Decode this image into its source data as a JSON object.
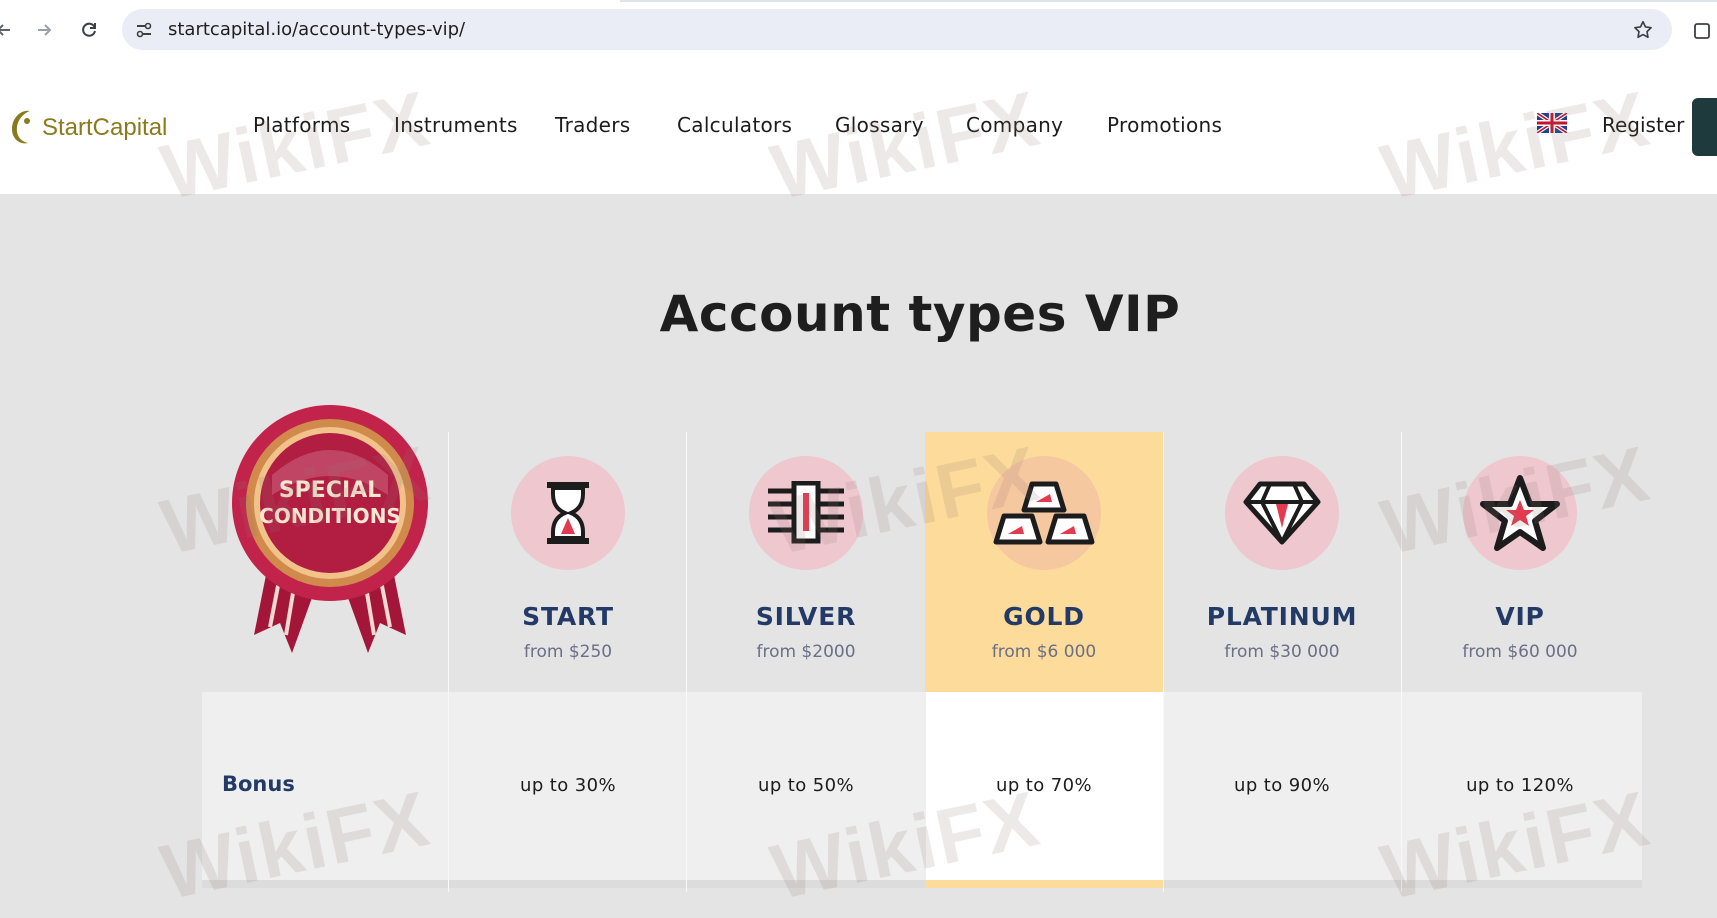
{
  "browser": {
    "url": "startcapital.io/account-types-vip/"
  },
  "header": {
    "logo_text": "StartCapital",
    "menu": [
      "Platforms",
      "Instruments",
      "Traders",
      "Calculators",
      "Glossary",
      "Company",
      "Promotions"
    ],
    "register_label": "Register"
  },
  "page": {
    "title": "Account types VIP"
  },
  "medal": {
    "line1": "SPECIAL",
    "line2": "CONDITIONS"
  },
  "plans": [
    {
      "name": "START",
      "min": "from $250",
      "icon": "hourglass-icon",
      "bonus": "up to 30%"
    },
    {
      "name": "SILVER",
      "min": "from $2000",
      "icon": "silver-bars-icon",
      "bonus": "up to 50%"
    },
    {
      "name": "GOLD",
      "min": "from $6 000",
      "icon": "gold-bars-icon",
      "bonus": "up to 70%"
    },
    {
      "name": "PLATINUM",
      "min": "from $30 000",
      "icon": "diamond-icon",
      "bonus": "up to 90%"
    },
    {
      "name": "VIP",
      "min": "from $60 000",
      "icon": "star-icon",
      "bonus": "up to 120%"
    }
  ],
  "bonus_row": {
    "label": "Bonus"
  },
  "watermark": "WikiFX",
  "colors": {
    "accent_navy": "#233a66",
    "gold_highlight": "#fddb9a",
    "icon_pink": "#eec7cf",
    "logo_olive": "#8a7a1e",
    "cta_dark": "#1f3a3d"
  }
}
